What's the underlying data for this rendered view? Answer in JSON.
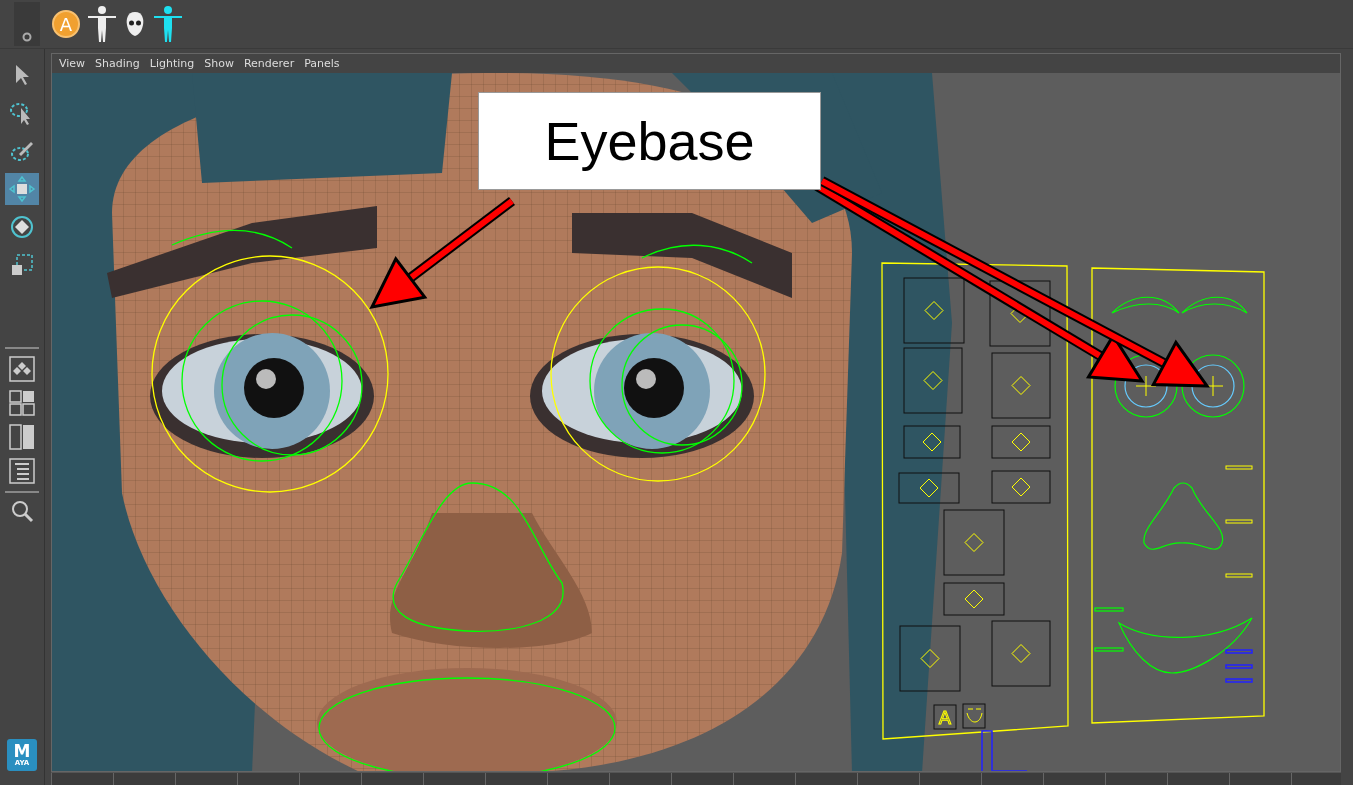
{
  "shelf": {
    "badge": "A"
  },
  "tools": [
    {
      "kind": "select",
      "selected": false
    },
    {
      "kind": "lasso",
      "selected": false
    },
    {
      "kind": "paint",
      "selected": false
    },
    {
      "kind": "move",
      "selected": true
    },
    {
      "kind": "rotate",
      "selected": false
    },
    {
      "kind": "scale",
      "selected": false
    }
  ],
  "layout_tools": [
    {
      "kind": "single"
    },
    {
      "kind": "four"
    },
    {
      "kind": "two"
    },
    {
      "kind": "outliner"
    }
  ],
  "logo": {
    "letter": "M",
    "word": "AYA"
  },
  "viewport": {
    "menu": [
      "View",
      "Shading",
      "Lighting",
      "Show",
      "Renderer",
      "Panels"
    ],
    "callout": "Eyebase",
    "rig_labels": [
      "A"
    ]
  }
}
